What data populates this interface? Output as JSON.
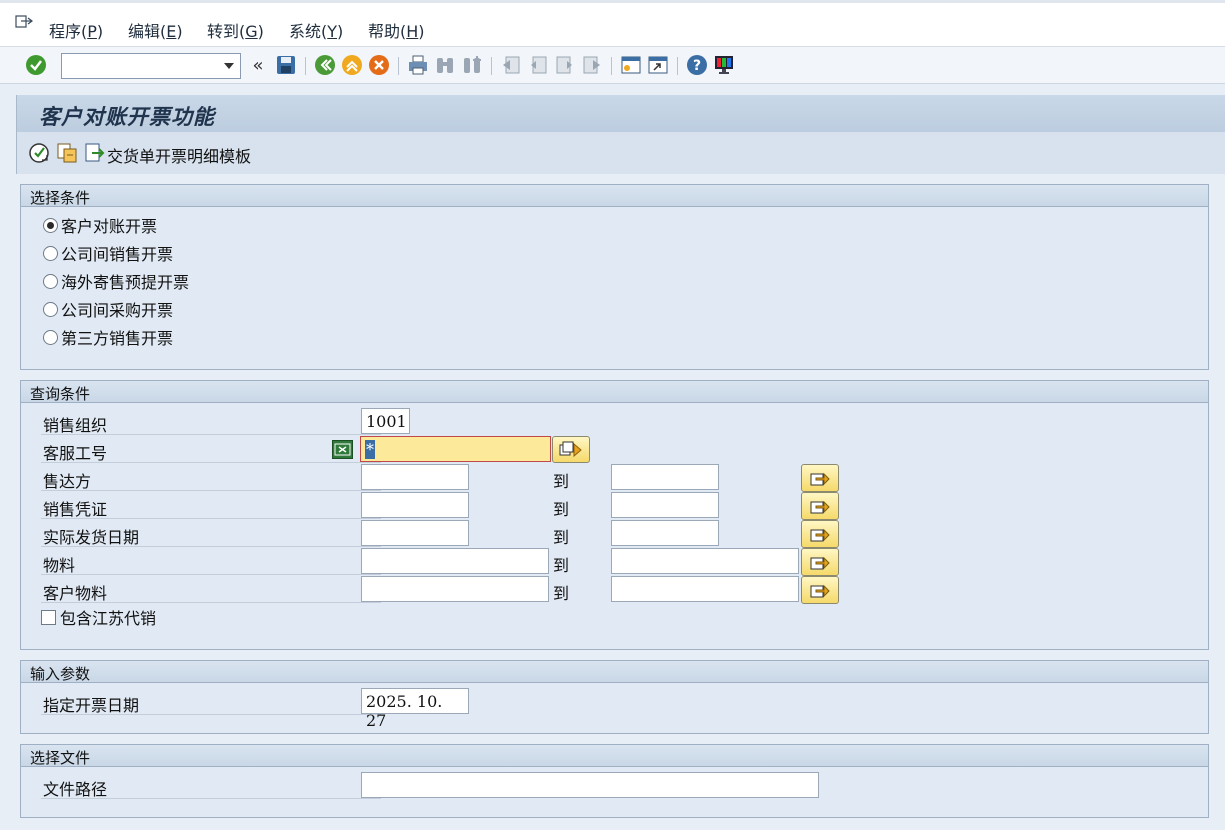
{
  "menu": [
    {
      "label": "程序(",
      "key": "P",
      "end": ")"
    },
    {
      "label": "编辑(",
      "key": "E",
      "end": ")"
    },
    {
      "label": "转到(",
      "key": "G",
      "end": ")"
    },
    {
      "label": "系统(",
      "key": "Y",
      "end": ")"
    },
    {
      "label": "帮助(",
      "key": "H",
      "end": ")"
    }
  ],
  "toolbar": {
    "command_value": "",
    "icons": [
      "enter-icon",
      "command-dropdown",
      "collapse-icon",
      "save-icon",
      "back-icon",
      "exit-icon",
      "cancel-icon",
      "print-icon",
      "find-icon",
      "find-next-icon",
      "first-page-icon",
      "previous-page-icon",
      "next-page-icon",
      "last-page-icon",
      "create-session-icon",
      "shortcut-icon",
      "help-icon",
      "customize-layout-icon"
    ]
  },
  "title": "客户对账开票功能",
  "app_toolbar": {
    "variant_label": "交货单开票明细模板"
  },
  "sections": {
    "selection": {
      "title": "选择条件",
      "options": [
        {
          "label": "客户对账开票",
          "selected": true
        },
        {
          "label": "公司间销售开票",
          "selected": false
        },
        {
          "label": "海外寄售预提开票",
          "selected": false
        },
        {
          "label": "公司间采购开票",
          "selected": false
        },
        {
          "label": "第三方销售开票",
          "selected": false
        }
      ]
    },
    "query": {
      "title": "查询条件",
      "to_label": "到",
      "fields": {
        "sales_org": {
          "label": "销售组织",
          "value": "1001"
        },
        "service_no": {
          "label": "客服工号",
          "value": "*"
        },
        "sold_to": {
          "label": "售达方",
          "from": "",
          "to": ""
        },
        "sales_doc": {
          "label": "销售凭证",
          "from": "",
          "to": ""
        },
        "goods_issue_date": {
          "label": "实际发货日期",
          "from": "",
          "to": ""
        },
        "material": {
          "label": "物料",
          "from": "",
          "to": ""
        },
        "customer_material": {
          "label": "客户物料",
          "from": "",
          "to": ""
        }
      },
      "include_checkbox": {
        "label": "包含江苏代销",
        "checked": false
      }
    },
    "input": {
      "title": "输入参数",
      "invoice_date": {
        "label": "指定开票日期",
        "value": "2025. 10. 27"
      }
    },
    "file": {
      "title": "选择文件",
      "path": {
        "label": "文件路径",
        "value": ""
      }
    }
  }
}
